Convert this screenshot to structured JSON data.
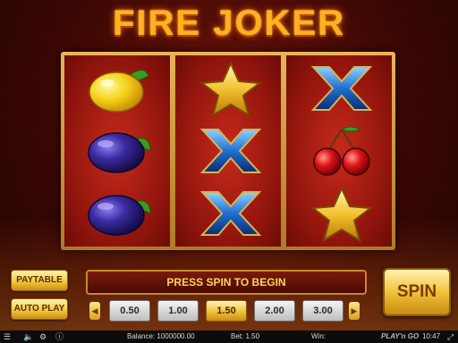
{
  "game": {
    "title": "FIRE JOKER"
  },
  "reels": [
    [
      "lemon",
      "plum",
      "plum"
    ],
    [
      "star",
      "x",
      "x"
    ],
    [
      "x",
      "cherries",
      "star"
    ]
  ],
  "controls": {
    "paytable_label": "PAYTABLE",
    "autoplay_label": "AUTO PLAY",
    "message": "PRESS SPIN TO BEGIN",
    "spin_label": "SPIN",
    "prev_bet_glyph": "◀",
    "next_bet_glyph": "▶",
    "bet_options": [
      "0.50",
      "1.00",
      "1.50",
      "2.00",
      "3.00"
    ],
    "selected_bet": "1.50"
  },
  "status": {
    "balance": "Balance: 1000000.00",
    "bet": "Bet: 1.50",
    "win": "Win:",
    "brand": "PLAY'n GO",
    "time": "10:47"
  },
  "colors": {
    "title": "#ffb21e",
    "reel_bg": "#c62a1a",
    "frame_gold": "#e8b45a",
    "button_gold": "#f3c93d"
  }
}
